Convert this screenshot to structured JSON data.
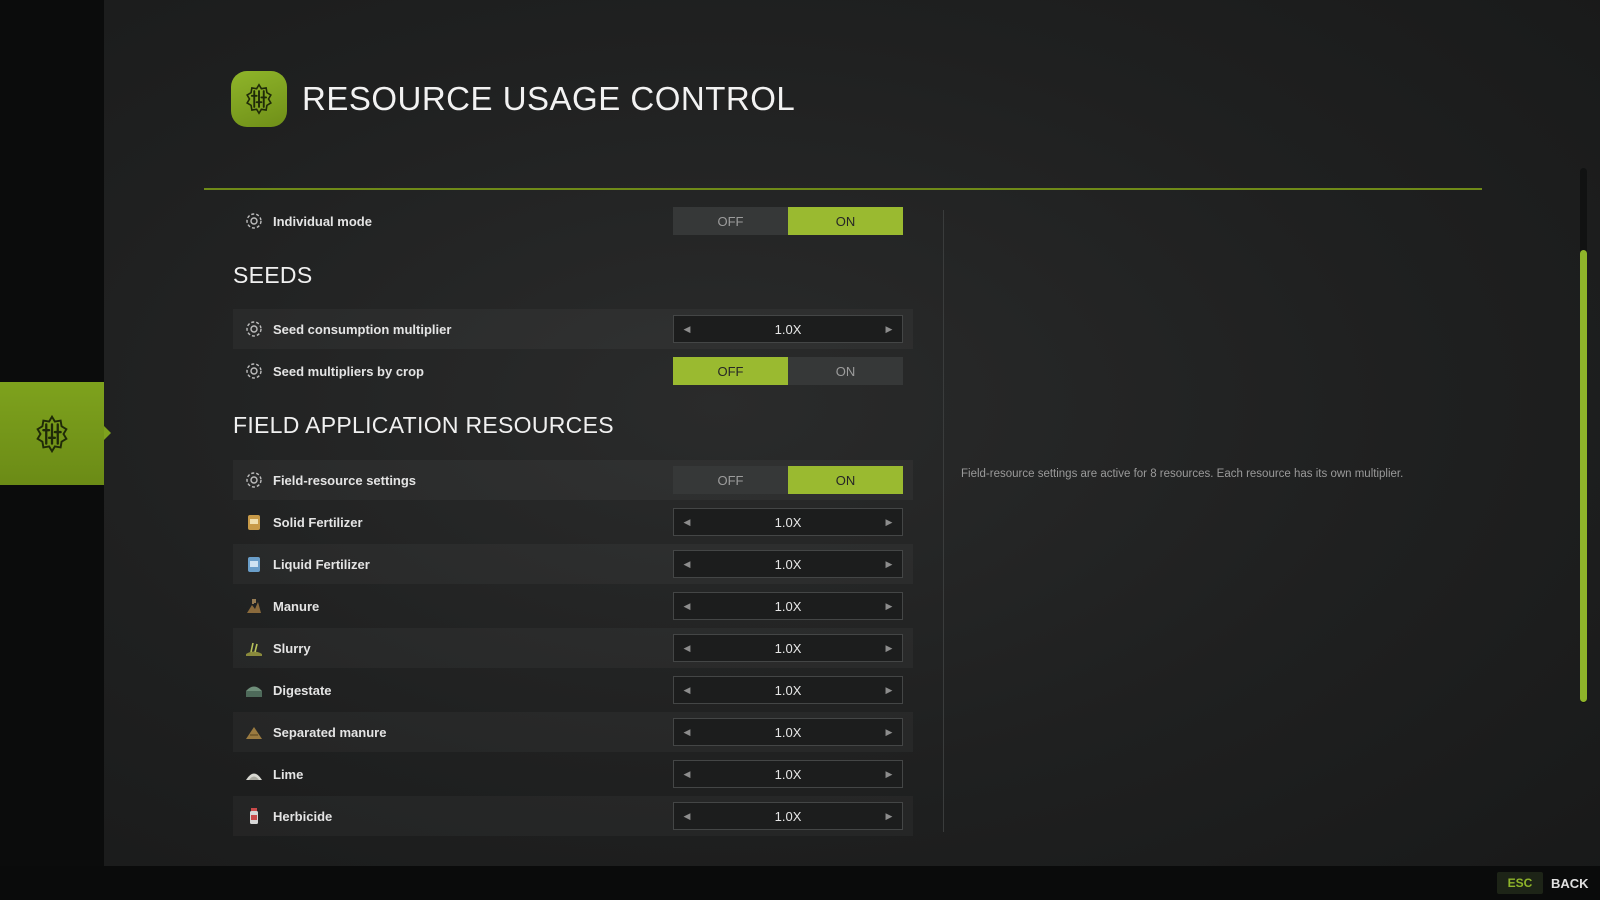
{
  "header": {
    "title": "RESOURCE USAGE CONTROL",
    "icon": "sliders-gear-icon"
  },
  "colors": {
    "accent": "#9aba30",
    "accent_dark": "#6f8f18",
    "background": "#1f2020",
    "rail": "#0b0c0c"
  },
  "general": {
    "individual_mode": {
      "label": "Individual mode",
      "icon": "gear-icon",
      "off": "OFF",
      "on": "ON",
      "selected": "ON"
    }
  },
  "seeds": {
    "title": "SEEDS",
    "consumption_multiplier": {
      "label": "Seed consumption multiplier",
      "icon": "gear-icon",
      "value": "1.0X"
    },
    "multipliers_by_crop": {
      "label": "Seed multipliers by crop",
      "icon": "gear-icon",
      "off": "OFF",
      "on": "ON",
      "selected": "OFF"
    }
  },
  "field": {
    "title": "FIELD APPLICATION RESOURCES",
    "settings": {
      "label": "Field-resource settings",
      "icon": "gear-icon",
      "off": "OFF",
      "on": "ON",
      "selected": "ON"
    },
    "resources": [
      {
        "label": "Solid Fertilizer",
        "icon": "solid-fertilizer-icon",
        "value": "1.0X"
      },
      {
        "label": "Liquid Fertilizer",
        "icon": "liquid-fertilizer-icon",
        "value": "1.0X"
      },
      {
        "label": "Manure",
        "icon": "manure-icon",
        "value": "1.0X"
      },
      {
        "label": "Slurry",
        "icon": "slurry-icon",
        "value": "1.0X"
      },
      {
        "label": "Digestate",
        "icon": "digestate-icon",
        "value": "1.0X"
      },
      {
        "label": "Separated manure",
        "icon": "separated-manure-icon",
        "value": "1.0X"
      },
      {
        "label": "Lime",
        "icon": "lime-icon",
        "value": "1.0X"
      },
      {
        "label": "Herbicide",
        "icon": "herbicide-icon",
        "value": "1.0X"
      }
    ]
  },
  "info": {
    "text": "Field-resource settings are active for 8 resources. Each resource has its own multiplier."
  },
  "footer": {
    "esc_key": "ESC",
    "back_label": "BACK"
  }
}
